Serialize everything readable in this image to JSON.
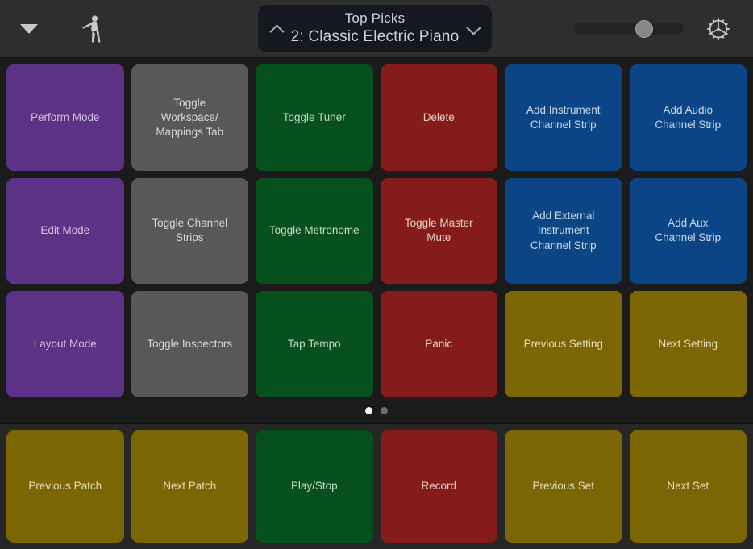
{
  "toolbar": {
    "menu_icon": "triangle-down-icon",
    "perform_icon": "performer-figure-icon",
    "settings_icon": "gear-icon",
    "patch_selector": {
      "prev_icon": "chevron-up-icon",
      "next_icon": "chevron-down-icon",
      "set_name": "Top Picks",
      "patch_name": "2: Classic Electric Piano"
    },
    "volume_slider": {
      "value_percent": 64
    }
  },
  "colors": {
    "purple": "#5b3285",
    "purple_text": "#cfc0de",
    "grey": "#585858",
    "grey_text": "#d6d6d6",
    "green": "#06501d",
    "green_text": "#c3dcca",
    "red": "#861c1a",
    "red_text": "#e8cfcd",
    "blue": "#0b4586",
    "blue_text": "#cbd9e9",
    "olive": "#7c6603",
    "olive_text": "#e5ddbd",
    "background": "#1b1b1b",
    "toolbar_background": "#2e2e2e",
    "bottom_background": "#262626"
  },
  "grid": {
    "rows": [
      [
        {
          "label": "Perform Mode",
          "color": "purple"
        },
        {
          "label": "Toggle\nWorkspace/\nMappings Tab",
          "color": "grey"
        },
        {
          "label": "Toggle Tuner",
          "color": "green"
        },
        {
          "label": "Delete",
          "color": "red"
        },
        {
          "label": "Add Instrument\nChannel Strip",
          "color": "blue"
        },
        {
          "label": "Add Audio\nChannel Strip",
          "color": "blue"
        }
      ],
      [
        {
          "label": "Edit Mode",
          "color": "purple"
        },
        {
          "label": "Toggle Channel\nStrips",
          "color": "grey"
        },
        {
          "label": "Toggle Metronome",
          "color": "green"
        },
        {
          "label": "Toggle Master\nMute",
          "color": "red"
        },
        {
          "label": "Add External\nInstrument\nChannel Strip",
          "color": "blue"
        },
        {
          "label": "Add Aux\nChannel Strip",
          "color": "blue"
        }
      ],
      [
        {
          "label": "Layout Mode",
          "color": "purple"
        },
        {
          "label": "Toggle Inspectors",
          "color": "grey"
        },
        {
          "label": "Tap Tempo",
          "color": "green"
        },
        {
          "label": "Panic",
          "color": "red"
        },
        {
          "label": "Previous Setting",
          "color": "olive"
        },
        {
          "label": "Next Setting",
          "color": "olive"
        }
      ]
    ]
  },
  "page_indicator": {
    "total": 2,
    "active_index": 0
  },
  "bottom_bar": {
    "buttons": [
      {
        "label": "Previous Patch",
        "color": "olive"
      },
      {
        "label": "Next Patch",
        "color": "olive"
      },
      {
        "label": "Play/Stop",
        "color": "green"
      },
      {
        "label": "Record",
        "color": "red"
      },
      {
        "label": "Previous Set",
        "color": "olive"
      },
      {
        "label": "Next Set",
        "color": "olive"
      }
    ]
  }
}
